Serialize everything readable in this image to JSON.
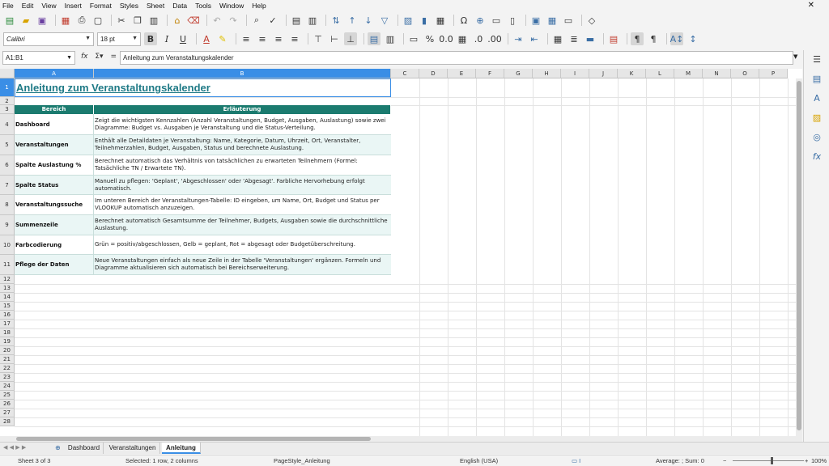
{
  "menu": [
    "File",
    "Edit",
    "View",
    "Insert",
    "Format",
    "Styles",
    "Sheet",
    "Data",
    "Tools",
    "Window",
    "Help"
  ],
  "font_name": "Calibri",
  "font_size": "18 pt",
  "cell_ref": "A1:B1",
  "formula_content": "Anleitung zum Veranstaltungskalender",
  "columns": [
    "A",
    "B",
    "C",
    "D",
    "E",
    "F",
    "G",
    "H",
    "I",
    "J",
    "K",
    "L",
    "M",
    "N",
    "O",
    "P"
  ],
  "title": "Anleitung zum Veranstaltungskalender",
  "table_headers": [
    "Bereich",
    "Erläuterung"
  ],
  "rows": [
    {
      "num": "4",
      "bereich": "Dashboard",
      "text": "Zeigt die wichtigsten Kennzahlen (Anzahl Veranstaltungen, Budget, Ausgaben, Auslastung) sowie zwei Diagramme: Budget vs. Ausgaben je Veranstaltung und die Status-Verteilung."
    },
    {
      "num": "5",
      "bereich": "Veranstaltungen",
      "text": "Enthält alle Detaildaten je Veranstaltung: Name, Kategorie, Datum, Uhrzeit, Ort, Veranstalter, Teilnehmerzahlen, Budget, Ausgaben, Status und berechnete Auslastung."
    },
    {
      "num": "6",
      "bereich": "Spalte Auslastung %",
      "text": "Berechnet automatisch das Verhältnis von tatsächlichen zu erwarteten Teilnehmern (Formel: Tatsächliche TN / Erwartete TN)."
    },
    {
      "num": "7",
      "bereich": "Spalte Status",
      "text": "Manuell zu pflegen: 'Geplant', 'Abgeschlossen' oder 'Abgesagt'. Farbliche Hervorhebung erfolgt automatisch."
    },
    {
      "num": "8",
      "bereich": "Veranstaltungssuche",
      "text": "Im unteren Bereich der Veranstaltungen-Tabelle: ID eingeben, um Name, Ort, Budget und Status per VLOOKUP automatisch anzuzeigen."
    },
    {
      "num": "9",
      "bereich": "Summenzeile",
      "text": "Berechnet automatisch Gesamtsumme der Teilnehmer, Budgets, Ausgaben sowie die durchschnittliche Auslastung."
    },
    {
      "num": "10",
      "bereich": "Farbcodierung",
      "text": "Grün = positiv/abgeschlossen, Gelb = geplant, Rot = abgesagt oder Budgetüberschreitung."
    },
    {
      "num": "11",
      "bereich": "Pflege der Daten",
      "text": "Neue Veranstaltungen einfach als neue Zeile in der Tabelle 'Veranstaltungen' ergänzen. Formeln und Diagramme aktualisieren sich automatisch bei Bereichserweiterung."
    }
  ],
  "row_numbers_top": [
    "1",
    "2",
    "3"
  ],
  "row_numbers_bottom": [
    "12",
    "13",
    "14",
    "15",
    "16",
    "17",
    "18",
    "19",
    "20",
    "21",
    "22",
    "23",
    "24",
    "25",
    "26",
    "27",
    "28"
  ],
  "tabs": [
    "Dashboard",
    "Veranstaltungen",
    "Anleitung"
  ],
  "active_tab": "Anleitung",
  "status": {
    "sheet": "Sheet 3 of 3",
    "selection": "Selected: 1 row, 2 columns",
    "page_style": "PageStyle_Anleitung",
    "language": "English (USA)",
    "summary": "Average: ; Sum: 0",
    "zoom": "100%"
  },
  "colors": {
    "accent": "#3a8ee6",
    "header_teal": "#1b7b6f",
    "title_teal": "#1f7a86",
    "row_tint": "#eaf6f5"
  }
}
